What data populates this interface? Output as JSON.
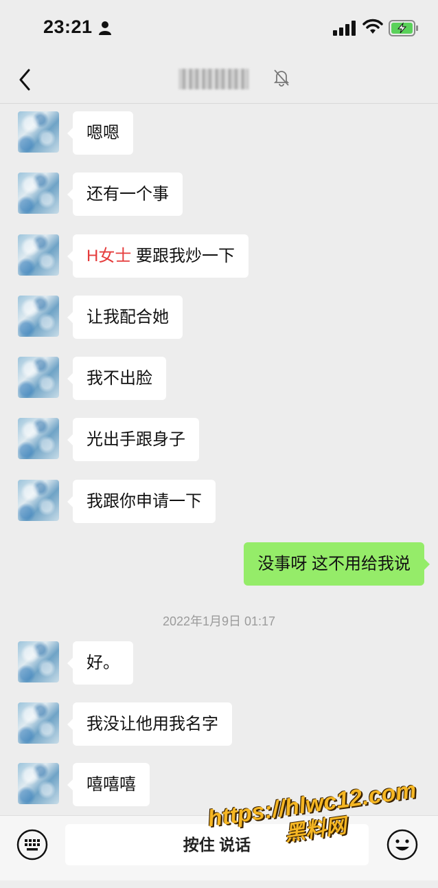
{
  "status_bar": {
    "time": "23:21"
  },
  "header": {
    "title": "",
    "muted_icon": "bell-muted-icon"
  },
  "messages": [
    {
      "text": "嗯嗯"
    },
    {
      "text": "还有一个事"
    },
    {
      "highlight": "H女士",
      "text": " 要跟我炒一下"
    },
    {
      "text": "让我配合她"
    },
    {
      "text": "我不出脸"
    },
    {
      "text": "光出手跟身子"
    },
    {
      "text": "我跟你申请一下"
    },
    {
      "text": "没事呀 这不用给我说"
    },
    {
      "text": "好。"
    },
    {
      "text": "我没让他用我名字"
    },
    {
      "text": "嘻嘻嘻"
    }
  ],
  "timestamp": "2022年1月9日 01:17",
  "input_bar": {
    "hold_to_talk": "按住 说话"
  },
  "watermark": {
    "line1": "https://hlwc12.com",
    "line2": "黑料网"
  },
  "colors": {
    "background": "#ededed",
    "my_bubble": "#95ec69",
    "highlight": "#e53c3c"
  }
}
